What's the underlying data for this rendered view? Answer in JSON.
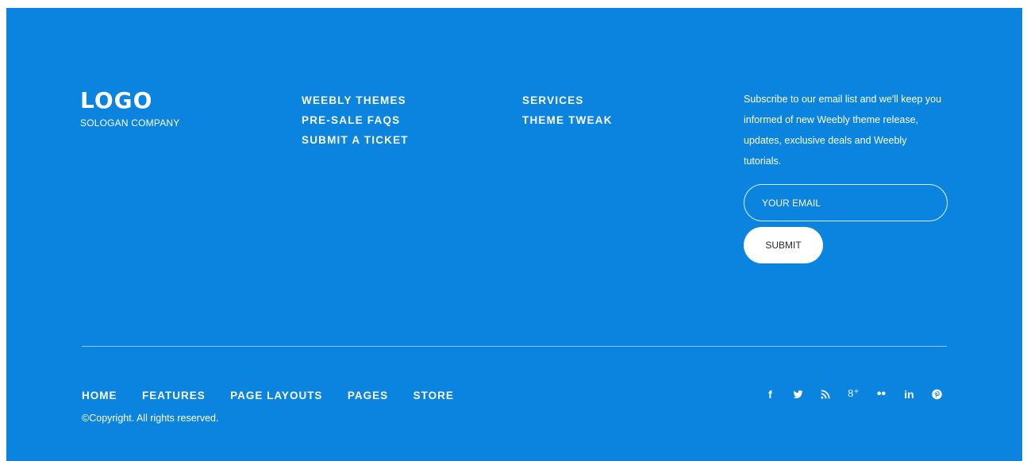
{
  "brand": {
    "logo": "LOGO",
    "slogan": "SOLOGAN COMPANY"
  },
  "links_col1": [
    "WEEBLY THEMES",
    "PRE-SALE FAQS",
    "SUBMIT A TICKET"
  ],
  "links_col2": [
    "SERVICES",
    "THEME TWEAK"
  ],
  "subscribe": {
    "text": "Subscribe to our email list and we'll keep you informed of new Weebly theme release, updates, exclusive deals and Weebly tutorials.",
    "placeholder": "YOUR EMAIL",
    "submit_label": "SUBMIT"
  },
  "bottom_nav": [
    "HOME",
    "FEATURES",
    "PAGE LAYOUTS",
    "PAGES",
    "STORE"
  ],
  "copyright": "©Copyright. All rights reserved.",
  "social": {
    "facebook": "f",
    "twitter": "twitter-icon",
    "rss": "rss-icon",
    "googleplus": "8⁺",
    "flickr": "••",
    "linkedin": "in",
    "pinterest": "pinterest-icon"
  },
  "colors": {
    "background": "#0a84de",
    "text": "#ffffff"
  }
}
